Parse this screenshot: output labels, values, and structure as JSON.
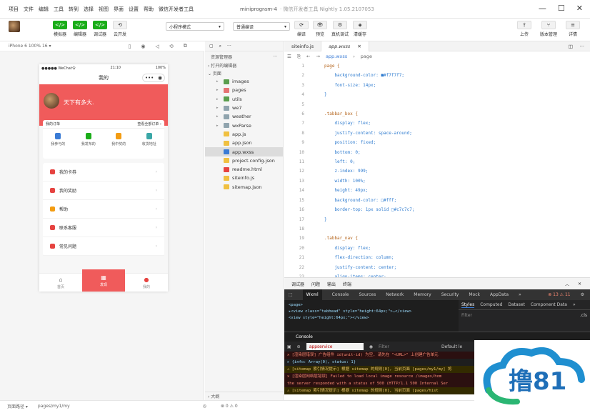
{
  "window": {
    "menus": [
      "项目",
      "文件",
      "编辑",
      "工具",
      "转到",
      "选择",
      "视图",
      "界面",
      "设置",
      "帮助",
      "微信开发者工具"
    ],
    "title": "miniprogram-4",
    "subtitle": "· 微信开发者工具 Nightly 1.05.2107053"
  },
  "toolbar": {
    "left": [
      {
        "icon": "</>",
        "label": "模拟器"
      },
      {
        "icon": "</>",
        "label": "编辑器"
      },
      {
        "icon": "</>",
        "label": "调试器"
      },
      {
        "icon": "⟲",
        "label": "云开发"
      }
    ],
    "mode": "小程序模式",
    "compile": "普通编译",
    "right": [
      {
        "icon": "⟳",
        "label": "编译"
      },
      {
        "icon": "👁",
        "label": "预览"
      },
      {
        "icon": "⚙",
        "label": "真机调试"
      },
      {
        "icon": "◈",
        "label": "清缓存"
      }
    ],
    "far": [
      {
        "icon": "⇪",
        "label": "上传"
      },
      {
        "icon": "⑂",
        "label": "版本管理"
      },
      {
        "icon": "≡",
        "label": "详情"
      }
    ]
  },
  "simulator": {
    "device": "iPhone 6 100% 16 ▾",
    "status_left": "●●●●● WeChat令",
    "time": "21:10",
    "battery": "100%",
    "nav_title": "我的",
    "slogan": "天下有多大.",
    "order_title": "我的订单",
    "order_all": "查看全部订单 ›",
    "order_ops": [
      {
        "label": "我参与的",
        "color": "#3a7bd5"
      },
      {
        "label": "我发布的",
        "color": "#1aad19"
      },
      {
        "label": "我中奖的",
        "color": "#f39c12"
      },
      {
        "label": "收货地址",
        "color": "#3aa7a7"
      }
    ],
    "menu": [
      {
        "label": "我的卡券",
        "color": "#e64340"
      },
      {
        "label": "我的奖励",
        "color": "#e64340"
      },
      {
        "label": "帮助",
        "color": "#f39c12"
      },
      {
        "label": "联系客服",
        "color": "#e64340"
      },
      {
        "label": "常见问题",
        "color": "#e64340"
      }
    ],
    "tabs": [
      {
        "label": "首页",
        "icon": "⌂"
      },
      {
        "label": "发现",
        "icon": "▦"
      },
      {
        "label": "我的",
        "icon": "●"
      }
    ]
  },
  "pathbar": {
    "label": "页面路径 ▾",
    "path": "pages/my1/my",
    "counts": "⊗ 0 ⚠ 0"
  },
  "explorer": {
    "title": "资源管理器",
    "open": "› 打开的编辑器",
    "root": "⌄ 页面",
    "files": [
      {
        "name": "images",
        "type": "folder",
        "color": "#5a9e4e"
      },
      {
        "name": "pages",
        "type": "folder",
        "color": "#e57373"
      },
      {
        "name": "utils",
        "type": "folder",
        "color": "#5a9e4e"
      },
      {
        "name": "we7",
        "type": "folder",
        "color": "#90a4ae"
      },
      {
        "name": "weather",
        "type": "folder",
        "color": "#90a4ae"
      },
      {
        "name": "wxParse",
        "type": "folder",
        "color": "#90a4ae"
      },
      {
        "name": "app.js",
        "type": "file",
        "color": "#f0c040"
      },
      {
        "name": "app.json",
        "type": "file",
        "color": "#f0c040"
      },
      {
        "name": "app.wxss",
        "type": "file",
        "color": "#3a7bd5"
      },
      {
        "name": "project.config.json",
        "type": "file",
        "color": "#f0c040"
      },
      {
        "name": "readme.html",
        "type": "file",
        "color": "#e64340"
      },
      {
        "name": "siteinfo.js",
        "type": "file",
        "color": "#f0c040"
      },
      {
        "name": "sitemap.json",
        "type": "file",
        "color": "#f0c040"
      }
    ],
    "outline": "› 大纲"
  },
  "editor": {
    "tabs": [
      "siteinfo.js",
      "app.wxss"
    ],
    "crumb": [
      "app.wxss",
      "page"
    ],
    "lines": [
      {
        "n": "1",
        "t": "page {"
      },
      {
        "n": "2",
        "t": "    background-color: ■#f7f7f7;"
      },
      {
        "n": "3",
        "t": "    font-size: 14px;"
      },
      {
        "n": "4",
        "t": "}"
      },
      {
        "n": "5",
        "t": ""
      },
      {
        "n": "6",
        "t": ".tabbar_box {"
      },
      {
        "n": "7",
        "t": "    display: flex;"
      },
      {
        "n": "8",
        "t": "    justify-content: space-around;"
      },
      {
        "n": "9",
        "t": "    position: fixed;"
      },
      {
        "n": "10",
        "t": "    bottom: 0;"
      },
      {
        "n": "11",
        "t": "    left: 0;"
      },
      {
        "n": "12",
        "t": "    z-index: 999;"
      },
      {
        "n": "13",
        "t": "    width: 100%;"
      },
      {
        "n": "14",
        "t": "    height: 49px;"
      },
      {
        "n": "15",
        "t": "    background-color: □#fff;"
      },
      {
        "n": "16",
        "t": "    border-top: 1px solid □#c7c7c7;"
      },
      {
        "n": "17",
        "t": "}"
      },
      {
        "n": "18",
        "t": ""
      },
      {
        "n": "19",
        "t": ".tabbar_nav {"
      },
      {
        "n": "20",
        "t": "    display: flex;"
      },
      {
        "n": "21",
        "t": "    flex-direction: column;"
      },
      {
        "n": "22",
        "t": "    justify-content: center;"
      },
      {
        "n": "23",
        "t": "    align-items: center;"
      }
    ]
  },
  "devtools": {
    "top": [
      "调试器",
      "问题",
      "输出",
      "终端"
    ],
    "tabs": [
      "Wxml",
      "Console",
      "Sources",
      "Network",
      "Memory",
      "Security",
      "Mock",
      "AppData",
      "»"
    ],
    "counts": "⊗ 13 ⚠ 11",
    "wxml": [
      "<page>",
      "  ▸<view class=\"tabhead\" style=\"height:64px;\">…</view>",
      "  <view style=\"height:64px;\"></view>"
    ],
    "style_tabs": [
      "Styles",
      "Computed",
      "Dataset",
      "Component Data",
      "»"
    ],
    "filter": "Filter",
    "cls": ".cls",
    "console_tab": "Console",
    "context": "appservice",
    "cfilter": "Filter",
    "levels": "Default le",
    "logs": [
      {
        "kind": "err",
        "t": "✕ [渲染层错误] 广告组件 id(unit-id) 为空, 请先在 \"<URL>\" 上创建广告单元"
      },
      {
        "kind": "plain",
        "t": "  ▸ {info: Array(0), status: 1}"
      },
      {
        "kind": "warn",
        "t": "⚠ [sitemap 索引情况提示] 根据 sitemap 的规则[0], 当前页面 [pages/my1/my] 将"
      },
      {
        "kind": "err",
        "t": "✕ [渲染层网络层错误] Failed to load local image resource /images/hom"
      },
      {
        "kind": "err",
        "t": "    the server responded with a status of 500 (HTTP/1.1 500 Internal Ser"
      },
      {
        "kind": "warn",
        "t": "⚠ [sitemap 索引情况提示] 根据 sitemap 的规则[0], 当前页面 [pages/hist"
      }
    ]
  },
  "watermark": {
    "text": "撸81"
  }
}
